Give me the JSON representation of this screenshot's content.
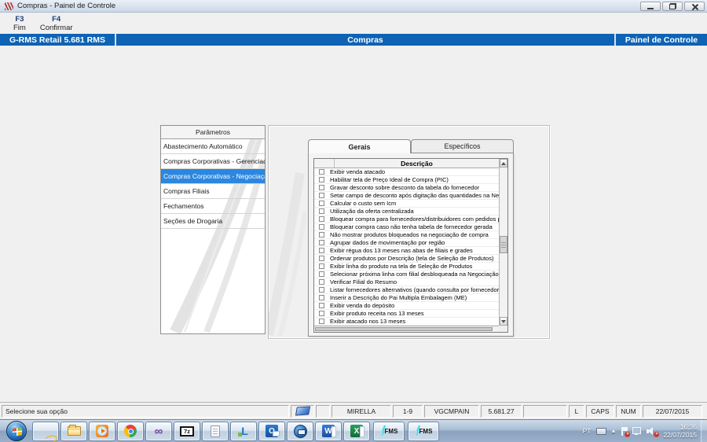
{
  "window": {
    "title": "Compras - Painel de Controle"
  },
  "toolbar": {
    "actions": [
      {
        "key": "F3",
        "label": "Fim"
      },
      {
        "key": "F4",
        "label": "Confirmar"
      }
    ]
  },
  "banner": {
    "left": "G-RMS Retail 5.681 RMS",
    "center": "Compras",
    "right": "Painel de Controle"
  },
  "parameters": {
    "title": "Parâmetros",
    "selected_index": 2,
    "items": [
      "Abastecimento Automático",
      "Compras Corporativas - Gerenciador",
      "Compras Corporativas - Negociação",
      "Compras Filiais",
      "Fechamentos",
      "Seções de Drogaria"
    ]
  },
  "tab_control": {
    "tabs": [
      {
        "label": "Gerais",
        "name": "tab-gerais",
        "active": true
      },
      {
        "label": "Específicos",
        "name": "tab-especificos",
        "active": false
      }
    ],
    "grid": {
      "header": "Descrição",
      "rows": [
        {
          "label": "Exibir venda atacado",
          "checked": false
        },
        {
          "label": "Habilitar tela de Preço Ideal de Compra (PIC)",
          "checked": false
        },
        {
          "label": "Gravar desconto sobre desconto da tabela do fornecedor",
          "checked": false
        },
        {
          "label": "Setar campo de desconto após digitação das quantidades na Negociaçã",
          "checked": false
        },
        {
          "label": "Calcular o custo sem Icm",
          "checked": false
        },
        {
          "label": "Utilização da oferta centralizada",
          "checked": false
        },
        {
          "label": "Bloquear compra para fornecedores/distribuidores com pedidos pendente",
          "checked": false
        },
        {
          "label": "Bloquear compra caso não tenha tabela de fornecedor gerada",
          "checked": false
        },
        {
          "label": "Não mostrar produtos bloqueados na negociação de compra",
          "checked": false
        },
        {
          "label": "Agrupar dados de movimentação por região",
          "checked": false
        },
        {
          "label": "Exibir régua dos 13 meses nas abas de filiais e grades",
          "checked": false
        },
        {
          "label": "Ordenar produtos por Descrição (tela de Seleção de Produtos)",
          "checked": false
        },
        {
          "label": "Exibir linha do produto na tela de Seleção de Produtos",
          "checked": false
        },
        {
          "label": "Selecionar próxima linha com filial desbloqueada na Negociação de Com",
          "checked": false
        },
        {
          "label": "Verificar Filial do Resumo",
          "checked": false
        },
        {
          "label": "Listar fornecedores alternativos (quando consulta por fornecedor)",
          "checked": false
        },
        {
          "label": "Inserir a Descrição do Pai Multipla Embalagem (ME)",
          "checked": false
        },
        {
          "label": "Exibir venda do depósito",
          "checked": false
        },
        {
          "label": "Exibir produto receita nos 13 meses",
          "checked": false
        },
        {
          "label": "Exibir atacado nos 13 meses",
          "checked": false
        }
      ]
    }
  },
  "status_bar": {
    "message": "Selecione sua opção",
    "cells": [
      "",
      "MIRELLA",
      "1-9",
      "VGCMPAIN",
      "5.681.27",
      "",
      "L",
      "CAPS",
      "NUM",
      "22/07/2015"
    ]
  },
  "taskbar": {
    "apps": [
      {
        "type": "ie",
        "name": "internet-explorer",
        "glyph": ""
      },
      {
        "type": "explorer",
        "name": "windows-explorer",
        "glyph": ""
      },
      {
        "type": "wmp",
        "name": "media-player",
        "glyph": ""
      },
      {
        "type": "chrome",
        "name": "chrome",
        "glyph": ""
      },
      {
        "type": "vs",
        "name": "visual-studio",
        "glyph": "∞"
      },
      {
        "type": "7z",
        "name": "7zip",
        "glyph": "7z"
      },
      {
        "type": "notepad",
        "name": "notepad",
        "glyph": ""
      },
      {
        "type": "lync",
        "name": "lync",
        "glyph": "L"
      },
      {
        "type": "outlook",
        "name": "outlook",
        "glyph": "O"
      },
      {
        "type": "remote",
        "name": "remote-desktop",
        "glyph": ""
      },
      {
        "type": "word",
        "name": "word",
        "glyph": "W"
      },
      {
        "type": "excel",
        "name": "excel",
        "glyph": "X"
      },
      {
        "type": "rms",
        "name": "rms-app",
        "glyph": "FMS"
      },
      {
        "type": "rms",
        "name": "rms-app",
        "glyph": "FMS"
      }
    ],
    "tray": {
      "lang": "PT",
      "expand_glyph": "▲",
      "time": "16:36",
      "date": "22/07/2015"
    }
  },
  "colors": {
    "banner": "#0E63B4",
    "selection": "#2B87DF"
  }
}
